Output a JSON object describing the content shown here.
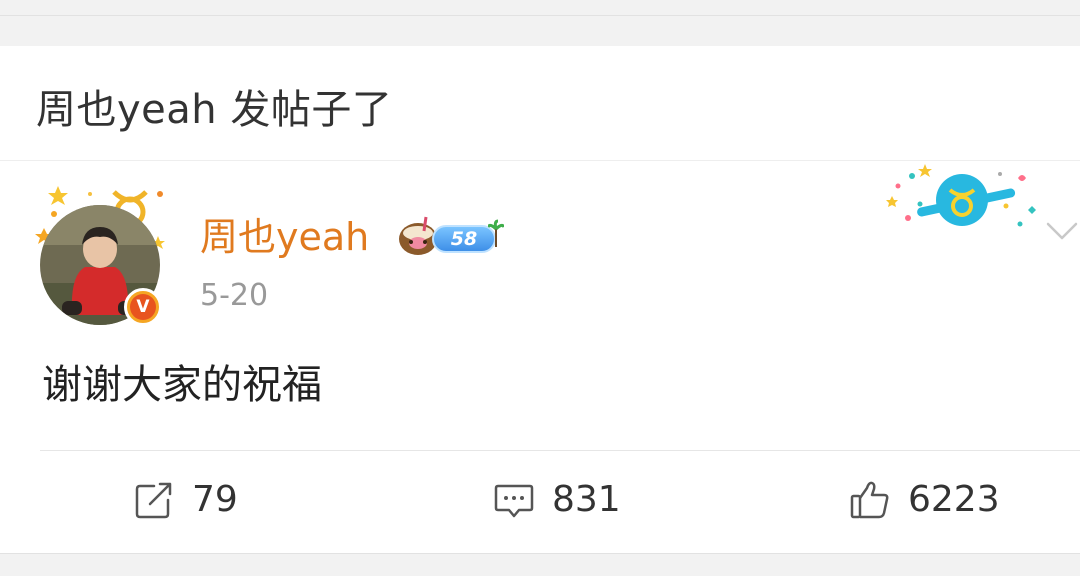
{
  "header": {
    "title": "周也yeah 发帖子了"
  },
  "post": {
    "username": "周也yeah",
    "level": "58",
    "date": "5-20",
    "verified_glyph": "V",
    "text": "谢谢大家的祝福"
  },
  "actions": {
    "repost_count": "79",
    "comment_count": "831",
    "like_count": "6223"
  },
  "icons": {
    "repost": "repost-icon",
    "comment": "comment-icon",
    "like": "thumbs-up-icon",
    "more": "chevron-down-icon",
    "zodiac": "taurus-icon"
  },
  "colors": {
    "username": "#e07a1f",
    "badge_blue": "#3e8fe8",
    "verified": "#e8541f",
    "zodiac_cyan": "#28b8e0"
  }
}
